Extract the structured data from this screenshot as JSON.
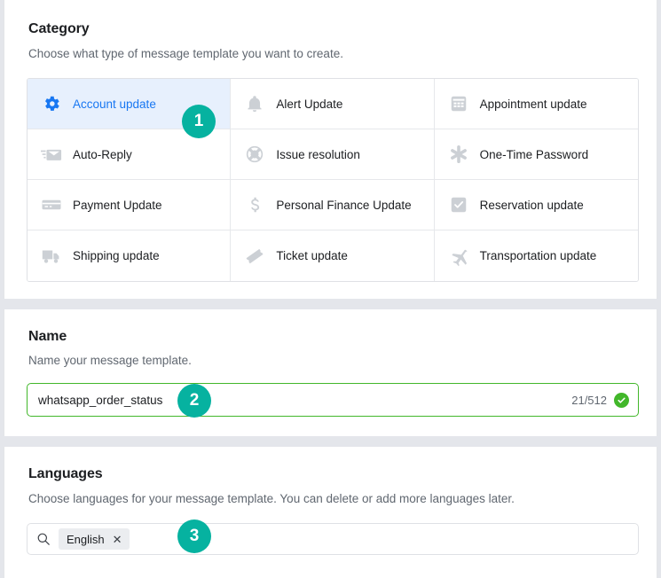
{
  "category": {
    "title": "Category",
    "subtitle": "Choose what type of message template you want to create.",
    "options": [
      {
        "label": "Account update",
        "icon": "gear-icon",
        "selected": true
      },
      {
        "label": "Alert Update",
        "icon": "bell-icon",
        "selected": false
      },
      {
        "label": "Appointment update",
        "icon": "calendar-icon",
        "selected": false
      },
      {
        "label": "Auto-Reply",
        "icon": "envelope-reply-icon",
        "selected": false
      },
      {
        "label": "Issue resolution",
        "icon": "life-ring-icon",
        "selected": false
      },
      {
        "label": "One-Time Password",
        "icon": "asterisk-icon",
        "selected": false
      },
      {
        "label": "Payment Update",
        "icon": "credit-card-icon",
        "selected": false
      },
      {
        "label": "Personal Finance Update",
        "icon": "dollar-sign-icon",
        "selected": false
      },
      {
        "label": "Reservation update",
        "icon": "checkbox-icon",
        "selected": false
      },
      {
        "label": "Shipping update",
        "icon": "truck-icon",
        "selected": false
      },
      {
        "label": "Ticket update",
        "icon": "ticket-icon",
        "selected": false
      },
      {
        "label": "Transportation update",
        "icon": "airplane-icon",
        "selected": false
      }
    ]
  },
  "name": {
    "title": "Name",
    "subtitle": "Name your message template.",
    "value": "whatsapp_order_status",
    "placeholder": "",
    "counter": "21/512",
    "valid_icon": "check-circle-icon"
  },
  "languages": {
    "title": "Languages",
    "subtitle": "Choose languages for your message template. You can delete or add more languages later.",
    "search_icon": "search-icon",
    "placeholder": "",
    "chips": [
      {
        "label": "English",
        "remove_icon": "close-icon"
      }
    ]
  },
  "step_badges": [
    {
      "number": "1"
    },
    {
      "number": "2"
    },
    {
      "number": "3"
    }
  ],
  "colors": {
    "accent_blue": "#1877f2",
    "selected_bg": "#e7f0fd",
    "badge_teal": "#06b2a0",
    "valid_green": "#42b72a",
    "icon_gray": "#ccd0d5",
    "page_bg": "#e4e6eb"
  }
}
